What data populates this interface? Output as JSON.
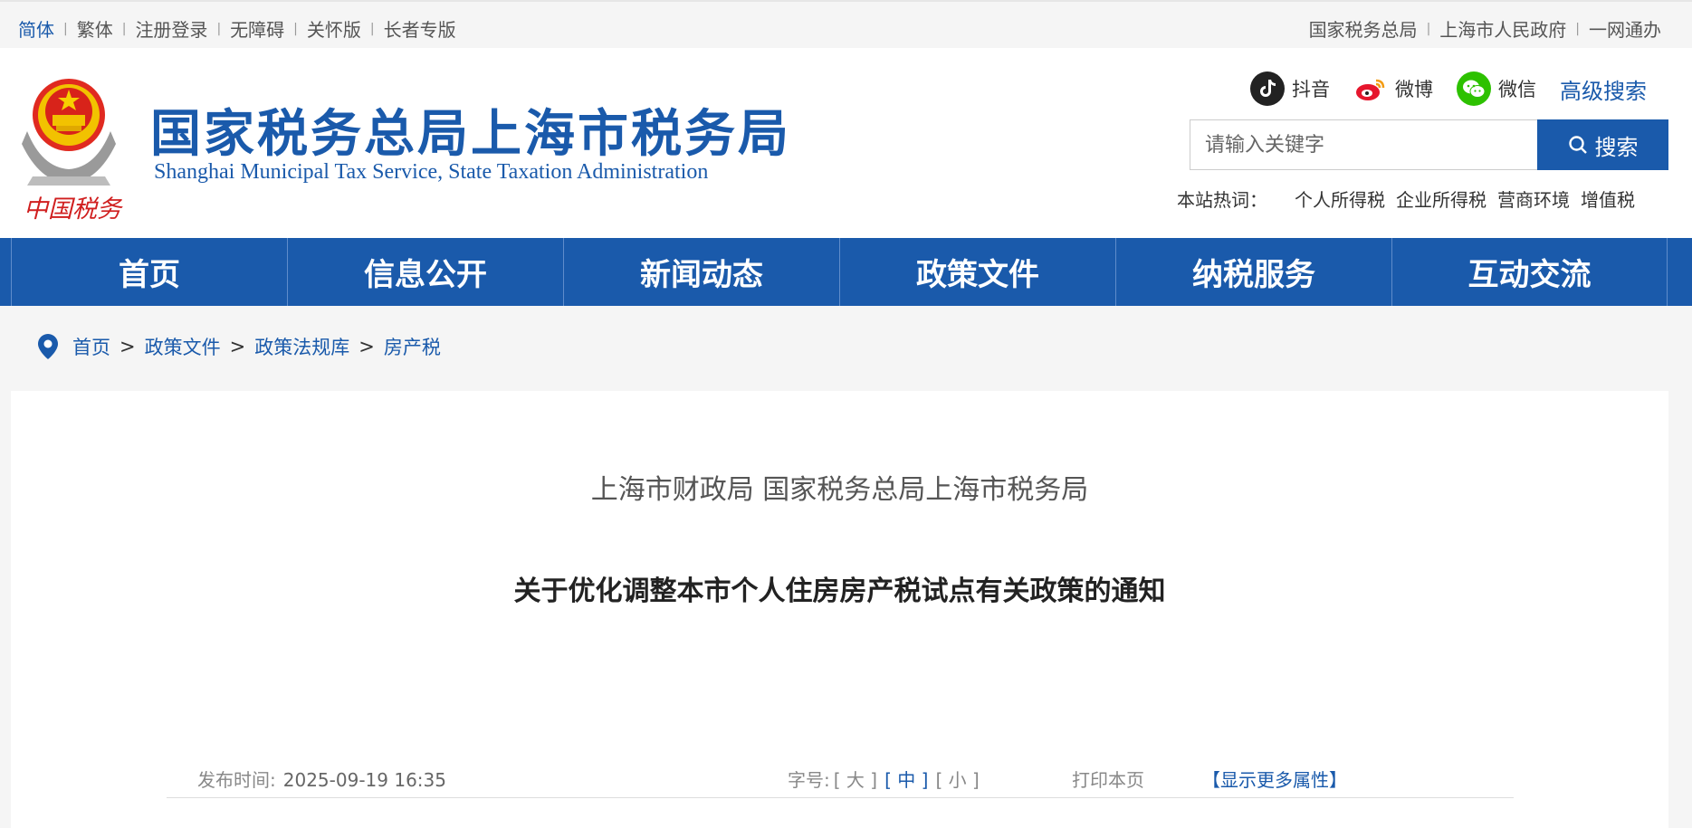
{
  "topbar": {
    "left": [
      "简体",
      "繁体",
      "注册登录",
      "无障碍",
      "关怀版",
      "长者专版"
    ],
    "right": [
      "国家税务总局",
      "上海市人民政府",
      "一网通办"
    ]
  },
  "header": {
    "emblem_text": "中国税务",
    "title_cn": "国家税务总局上海市税务局",
    "title_en": "Shanghai Municipal Tax Service, State Taxation Administration",
    "social": [
      "抖音",
      "微博",
      "微信"
    ],
    "advanced_search": "高级搜索",
    "search_placeholder": "请输入关键字",
    "search_button": "搜索",
    "hot_label": "本站热词：",
    "hot_words": [
      "个人所得税",
      "企业所得税",
      "营商环境",
      "增值税"
    ]
  },
  "nav": [
    "首页",
    "信息公开",
    "新闻动态",
    "政策文件",
    "纳税服务",
    "互动交流"
  ],
  "breadcrumb": [
    "首页",
    "政策文件",
    "政策法规库",
    "房产税"
  ],
  "article": {
    "issuer": "上海市财政局 国家税务总局上海市税务局",
    "title": "关于优化调整本市个人住房房产税试点有关政策的通知",
    "publish_label": "发布时间:",
    "publish_value": "2025-09-19 16:35",
    "font_size_label": "字号:",
    "font_sizes": [
      "大",
      "中",
      "小"
    ],
    "print": "打印本页",
    "more_props": "【显示更多属性】"
  },
  "colors": {
    "brand_blue": "#1a5aab",
    "douyin": "#222222",
    "weibo": "#e6162d",
    "wechat": "#2dc100"
  }
}
